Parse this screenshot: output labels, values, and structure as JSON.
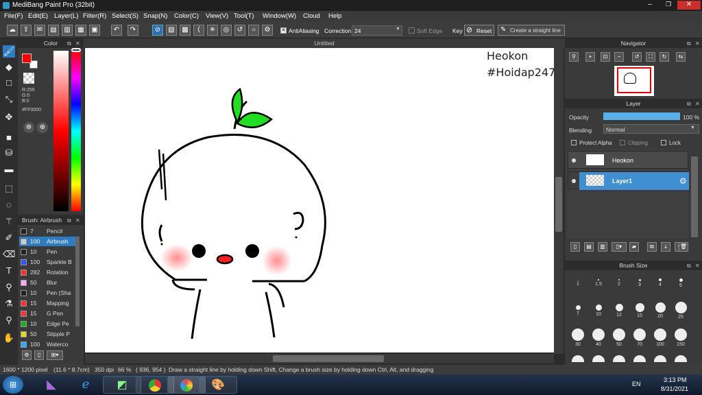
{
  "window": {
    "title": "MediBang Paint Pro (32bit)"
  },
  "menu": [
    "File(F)",
    "Edit(E)",
    "Layer(L)",
    "Filter(R)",
    "Select(S)",
    "Snap(N)",
    "Color(C)",
    "View(V)",
    "Tool(T)",
    "Window(W)",
    "Cloud",
    "Help"
  ],
  "toolbar": {
    "antialiasing": "AntiAliasing",
    "correction_label": "Correction",
    "correction_value": "24",
    "soft_edge": "Soft Edge",
    "key_label": "Key",
    "reset": "Reset",
    "straight_line": "Create a straight line"
  },
  "color_panel": {
    "title": "Color",
    "r": "R:255",
    "g": "G:0",
    "b": "B:0",
    "hex": "#FF0000",
    "fg": "#ff0000"
  },
  "brush_panel": {
    "title": "Brush: Airbrush",
    "items": [
      {
        "size": "7",
        "name": "Pencil",
        "color": "#222222"
      },
      {
        "size": "100",
        "name": "Airbrush",
        "color": "#cccccc"
      },
      {
        "size": "10",
        "name": "Pen",
        "color": "#222222"
      },
      {
        "size": "100",
        "name": "Sparkle B",
        "color": "#3355ff"
      },
      {
        "size": "282",
        "name": "Rotation",
        "color": "#ff3333"
      },
      {
        "size": "50",
        "name": "Blur",
        "color": "#ffaaff"
      },
      {
        "size": "10",
        "name": "Pen (Sha",
        "color": "#222222"
      },
      {
        "size": "15",
        "name": "Mapping",
        "color": "#ff3333"
      },
      {
        "size": "15",
        "name": "G Pen",
        "color": "#ff3333"
      },
      {
        "size": "10",
        "name": "Edge Pe",
        "color": "#22aa22"
      },
      {
        "size": "50",
        "name": "Stipple P",
        "color": "#dddd22"
      },
      {
        "size": "100",
        "name": "Waterco",
        "color": "#33aaff"
      }
    ]
  },
  "canvas": {
    "tab": "Untitled",
    "text_line1": "Heokon",
    "text_line2": "#Hoidap247"
  },
  "navigator": {
    "title": "Navigator"
  },
  "layer_panel": {
    "title": "Layer",
    "opacity_label": "Opacity",
    "opacity_value": "100 %",
    "opacity": 1.0,
    "blending_label": "Blending",
    "blending_value": "Normal",
    "protect_alpha": "Protect Alpha",
    "clipping": "Clipping",
    "lock": "Lock",
    "layers": [
      "Heokon",
      "Layer1"
    ]
  },
  "brush_size": {
    "title": "Brush Size",
    "sizes": [
      "1",
      "1.5",
      "2",
      "3",
      "4",
      "5",
      "7",
      "10",
      "12",
      "15",
      "20",
      "25",
      "30",
      "40",
      "50",
      "70",
      "100",
      "150"
    ]
  },
  "status": {
    "dimensions": "1600 * 1200 pixel",
    "physical": "(11.6 * 8.7cm)",
    "dpi": "350 dpi",
    "zoom": "66 %",
    "coords": "( 936, 954 )",
    "hint": "Draw a straight line by holding down Shift, Change a brush size by holding down Ctrl, Alt, and dragging"
  },
  "taskbar": {
    "lang": "EN",
    "time": "3:13 PM",
    "date": "8/31/2021"
  }
}
